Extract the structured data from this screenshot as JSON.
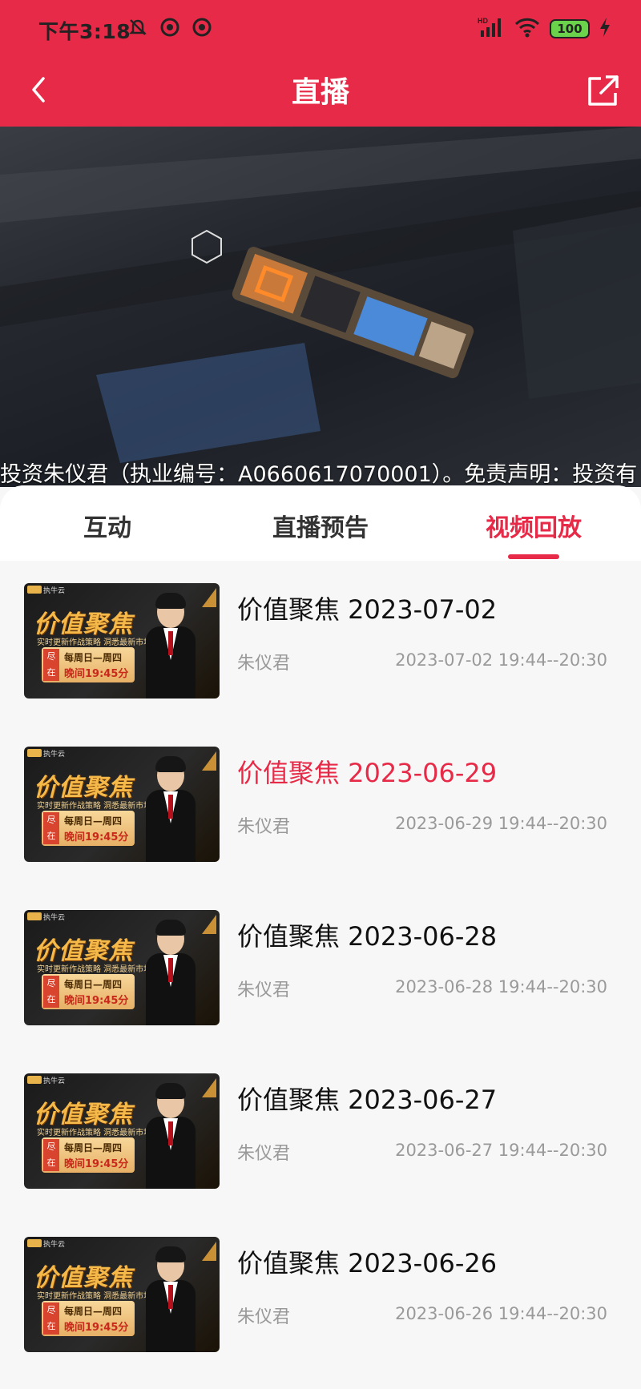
{
  "status": {
    "time": "下午3:18",
    "battery": "100",
    "network": "HD"
  },
  "nav": {
    "title": "直播"
  },
  "ticker": "投资朱仪君（执业编号：A0660617070001）。免责声明：投资有",
  "tabs": [
    {
      "label": "互动",
      "active": false
    },
    {
      "label": "直播预告",
      "active": false
    },
    {
      "label": "视频回放",
      "active": true
    }
  ],
  "thumb": {
    "brand": "执牛云",
    "headline": "价值聚焦",
    "subline": "实时更新作战策略  洞悉最新市场风口",
    "tag": "尽在",
    "days": "每周日—周四",
    "time": "晚间19:45分"
  },
  "items": [
    {
      "title": "价值聚焦 2023-07-02",
      "author": "朱仪君",
      "time": "2023-07-02 19:44--20:30",
      "highlight": false
    },
    {
      "title": "价值聚焦 2023-06-29",
      "author": "朱仪君",
      "time": "2023-06-29 19:44--20:30",
      "highlight": true
    },
    {
      "title": "价值聚焦 2023-06-28",
      "author": "朱仪君",
      "time": "2023-06-28 19:44--20:30",
      "highlight": false
    },
    {
      "title": "价值聚焦 2023-06-27",
      "author": "朱仪君",
      "time": "2023-06-27 19:44--20:30",
      "highlight": false
    },
    {
      "title": "价值聚焦 2023-06-26",
      "author": "朱仪君",
      "time": "2023-06-26 19:44--20:30",
      "highlight": false
    }
  ],
  "colors": {
    "accent": "#e62a47",
    "text_secondary": "#999999"
  }
}
